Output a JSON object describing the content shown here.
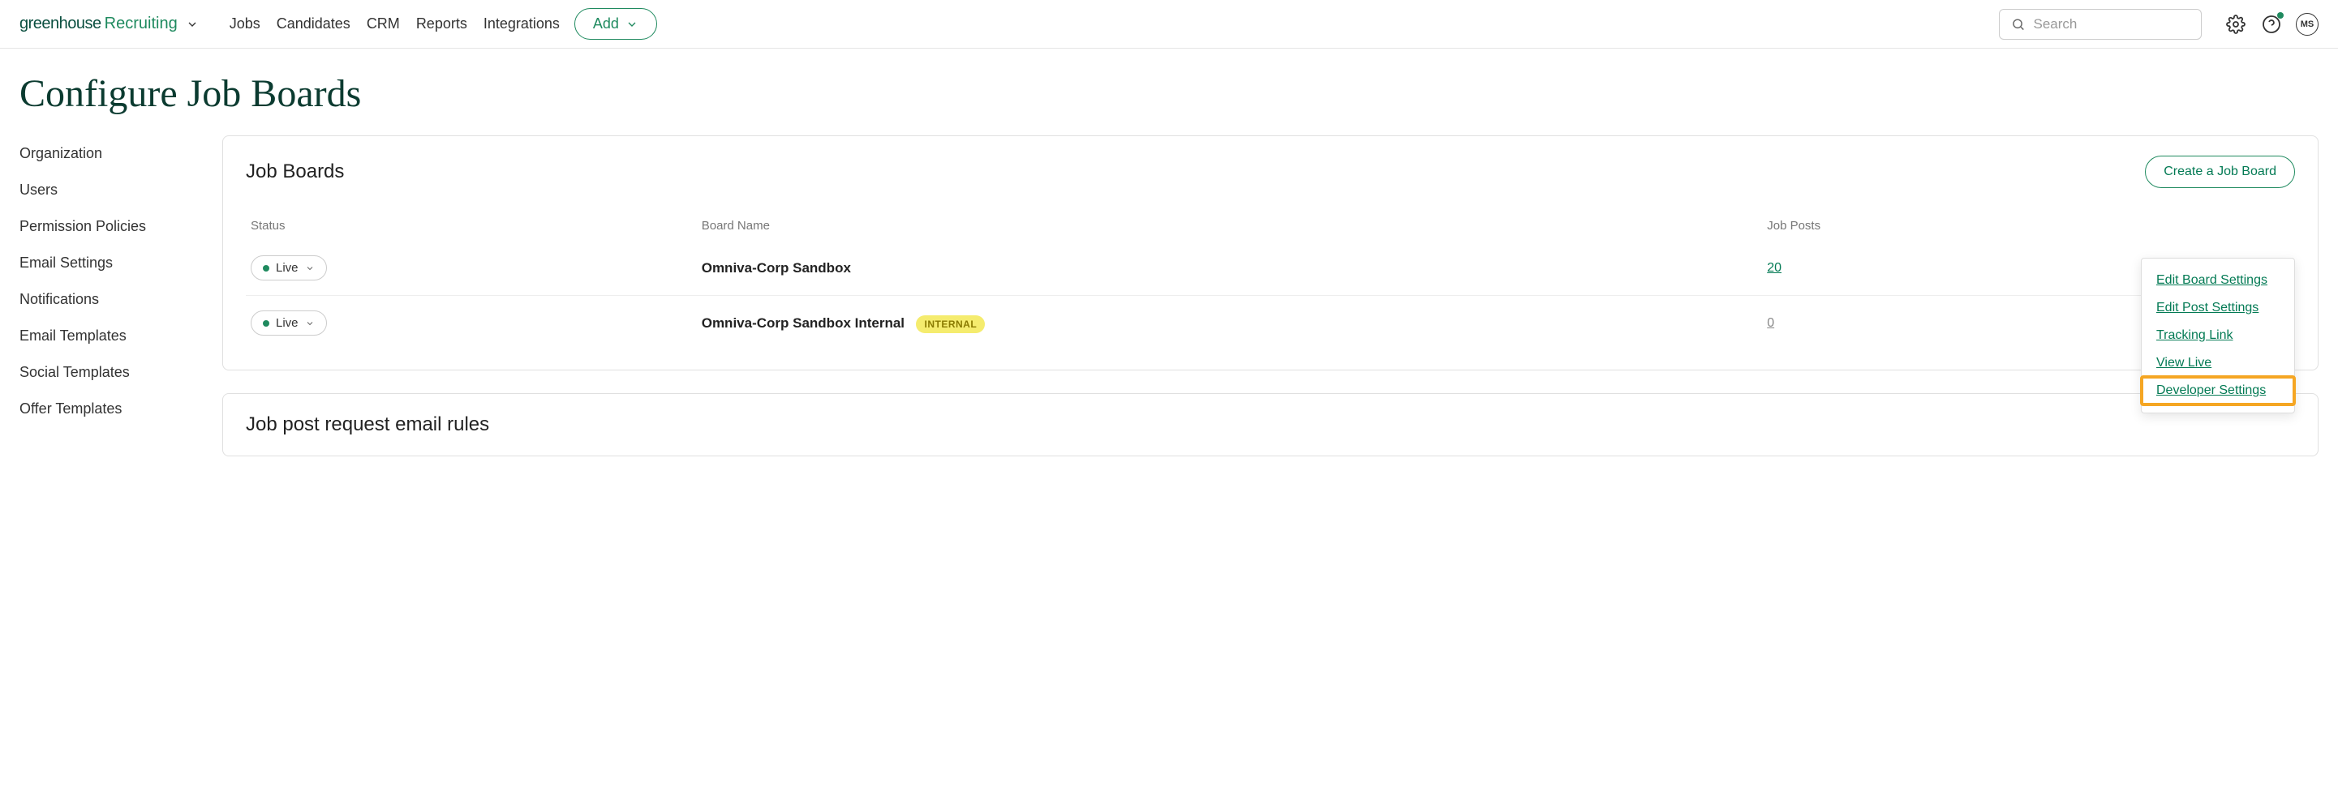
{
  "header": {
    "logo_g": "greenhouse",
    "logo_r": "Recruiting",
    "nav": [
      "Jobs",
      "Candidates",
      "CRM",
      "Reports",
      "Integrations"
    ],
    "add_label": "Add",
    "search_placeholder": "Search",
    "avatar_initials": "MS"
  },
  "page_title": "Configure Job Boards",
  "sidebar": {
    "items": [
      "Organization",
      "Users",
      "Permission Policies",
      "Email Settings",
      "Notifications",
      "Email Templates",
      "Social Templates",
      "Offer Templates"
    ]
  },
  "job_boards_panel": {
    "title": "Job Boards",
    "create_label": "Create a Job Board",
    "columns": {
      "status": "Status",
      "name": "Board Name",
      "posts": "Job Posts"
    },
    "rows": [
      {
        "status": "Live",
        "name": "Omniva-Corp Sandbox",
        "internal": false,
        "posts": "20",
        "posts_active": true
      },
      {
        "status": "Live",
        "name": "Omniva-Corp Sandbox Internal",
        "internal": true,
        "internal_badge": "INTERNAL",
        "posts": "0",
        "posts_active": false
      }
    ],
    "menu_items": [
      {
        "label": "Edit Board Settings",
        "highlight": false
      },
      {
        "label": "Edit Post Settings",
        "highlight": false
      },
      {
        "label": "Tracking Link",
        "highlight": false
      },
      {
        "label": "View Live",
        "highlight": false
      },
      {
        "label": "Developer Settings",
        "highlight": true
      }
    ]
  },
  "rules_panel": {
    "title": "Job post request email rules"
  }
}
